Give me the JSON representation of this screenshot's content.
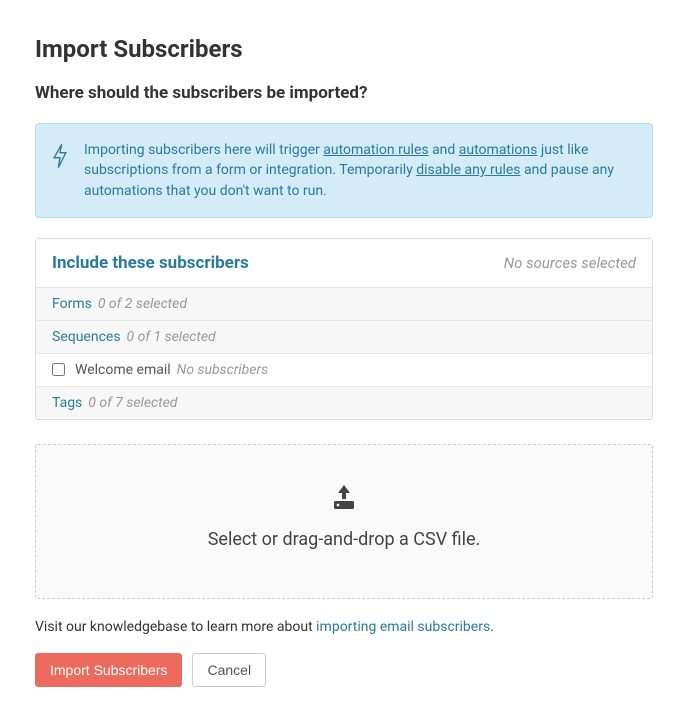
{
  "page": {
    "title": "Import Subscribers",
    "subtitle": "Where should the subscribers be imported?"
  },
  "info": {
    "text_before_link1": "Importing subscribers here will trigger ",
    "link1": "automation rules",
    "text_between_links": " and ",
    "link2": "automations",
    "text_after_link2": " just like subscriptions from a form or integration. Temporarily ",
    "link3": "disable any rules",
    "text_after_link3": " and pause any automations that you don't want to run."
  },
  "panel": {
    "header_title": "Include these subscribers",
    "header_hint": "No sources selected",
    "groups": {
      "forms": {
        "title": "Forms",
        "hint": "0 of 2 selected"
      },
      "sequences": {
        "title": "Sequences",
        "hint": "0 of 1 selected"
      },
      "tags": {
        "title": "Tags",
        "hint": "0 of 7 selected"
      }
    },
    "items": {
      "welcome_email": {
        "label": "Welcome email",
        "hint": "No subscribers"
      }
    }
  },
  "dropzone": {
    "text": "Select or drag-and-drop a CSV file."
  },
  "help": {
    "text_before": "Visit our knowledgebase to learn more about ",
    "link": "importing email subscribers",
    "text_after": "."
  },
  "buttons": {
    "submit": "Import Subscribers",
    "cancel": "Cancel"
  }
}
